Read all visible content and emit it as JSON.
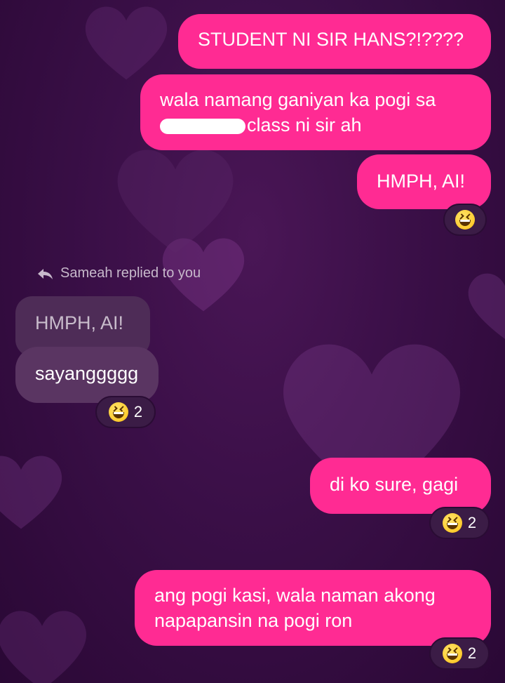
{
  "messages": {
    "m1": "STUDENT NI SIR HANS?!????",
    "m2_line1": "wala namang ganiyan ka pogi sa",
    "m2_line2": "class ni sir ah",
    "m3": "HMPH, AI!",
    "reply_note": "Sameah replied to you",
    "quoted": "HMPH, AI!",
    "m4": "sayanggggg",
    "m5": "di ko sure, gagi",
    "m6_line1": "ang pogi kasi, wala naman akong",
    "m6_line2": "napapansin na pogi ron"
  },
  "reactions": {
    "r1": {
      "icon": "laughing-emoji-icon",
      "count": ""
    },
    "r2": {
      "icon": "laughing-emoji-icon",
      "count": "2"
    },
    "r3": {
      "icon": "laughing-emoji-icon",
      "count": "2"
    },
    "r4": {
      "icon": "laughing-emoji-icon",
      "count": "2"
    }
  },
  "colors": {
    "outgoing_bubble": "#ff2b93",
    "incoming_bubble": "#5a3562",
    "background": "#3a0f47"
  }
}
